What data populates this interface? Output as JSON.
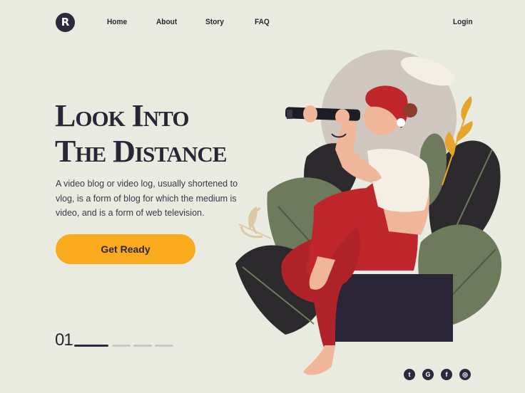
{
  "logo": {
    "letter": "R"
  },
  "nav": {
    "home": "Home",
    "about": "About",
    "story": "Story",
    "faq": "FAQ",
    "login": "Login"
  },
  "hero": {
    "title_line1": "Look Into",
    "title_line2": "The Distance",
    "description": "A video blog or video log, usually shortened to vlog, is a form of blog for which the medium is video, and is a form of web television.",
    "cta_label": "Get Ready"
  },
  "slider": {
    "current": "01",
    "total_dots": 4,
    "active_index": 0
  },
  "social": {
    "icons": [
      "twitter-icon",
      "google-icon",
      "facebook-icon",
      "instagram-icon"
    ],
    "glyphs": [
      "t",
      "G",
      "f",
      "◎"
    ]
  },
  "colors": {
    "background": "#e9eae0",
    "accent": "#f9aa1d",
    "dark": "#2d2a3e",
    "red": "#c0272d",
    "leaf_green": "#6d7b5c"
  }
}
